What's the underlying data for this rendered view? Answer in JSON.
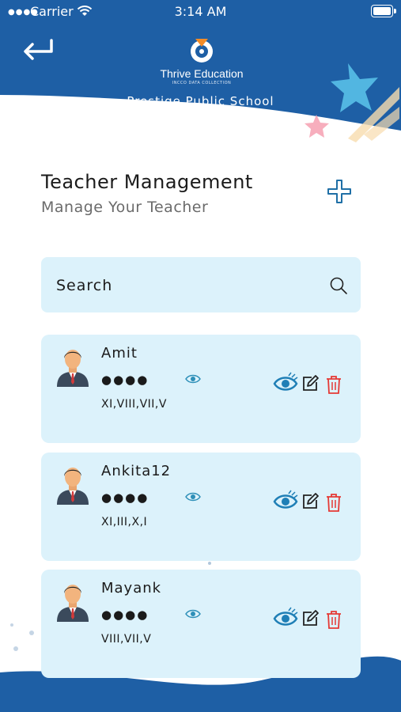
{
  "status_bar": {
    "carrier": "Carrier",
    "time": "3:14 AM"
  },
  "header": {
    "logo_name": "Thrive Education",
    "logo_tagline": "INCCO DATA COLLECTION",
    "school_name": "Prestige Public School"
  },
  "page": {
    "title": "Teacher Management",
    "subtitle": "Manage Your Teacher"
  },
  "search": {
    "placeholder": "Search"
  },
  "teachers": [
    {
      "name": "Amit",
      "password_mask": "●●●●",
      "classes": "XI,VIII,VII,V"
    },
    {
      "name": "Ankita12",
      "password_mask": "●●●●",
      "classes": "XI,III,X,I"
    },
    {
      "name": "Mayank",
      "password_mask": "●●●●",
      "classes": "VIII,VII,V"
    }
  ],
  "colors": {
    "brand_blue": "#1e5fa5",
    "card_bg": "#dcf2fb",
    "delete_red": "#e53935",
    "view_blue": "#1f7fb6"
  },
  "icons": [
    "back-arrow-icon",
    "add-icon",
    "search-icon",
    "eye-icon",
    "edit-icon",
    "trash-icon",
    "teacher-avatar"
  ]
}
